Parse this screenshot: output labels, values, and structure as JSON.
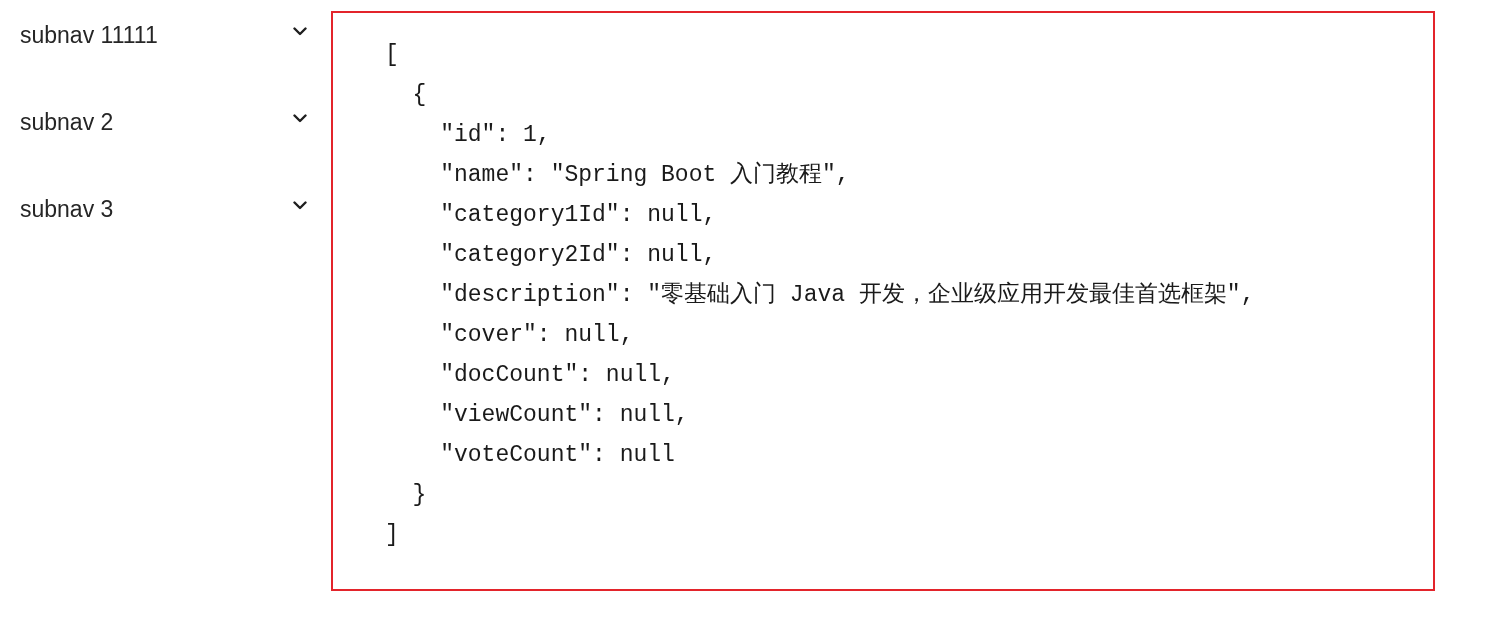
{
  "sidebar": {
    "items": [
      {
        "label": "subnav 11111",
        "expanded": false
      },
      {
        "label": "subnav 2",
        "expanded": false
      },
      {
        "label": "subnav 3",
        "expanded": false
      }
    ]
  },
  "code_block": {
    "lines": [
      "[",
      "  {",
      "    \"id\": 1,",
      "    \"name\": \"Spring Boot 入门教程\",",
      "    \"category1Id\": null,",
      "    \"category2Id\": null,",
      "    \"description\": \"零基础入门 Java 开发，企业级应用开发最佳首选框架\",",
      "    \"cover\": null,",
      "    \"docCount\": null,",
      "    \"viewCount\": null,",
      "    \"voteCount\": null",
      "  }",
      "]"
    ]
  }
}
